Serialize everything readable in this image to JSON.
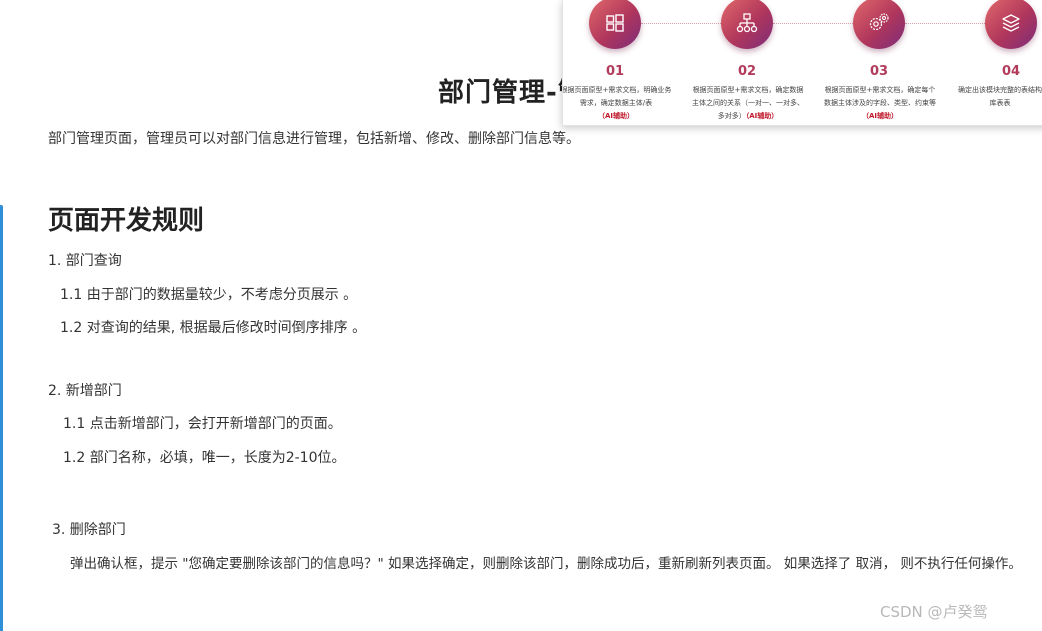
{
  "doc": {
    "title": "部门管理-管理",
    "intro": "部门管理页面，管理员可以对部门信息进行管理，包括新增、修改、删除部门信息等。",
    "section_title": "页面开发规则",
    "items": [
      {
        "heading": "1. 部门查询",
        "subs": [
          "1.1  由于部门的数据量较少，不考虑分页展示 。",
          "1.2  对查询的结果, 根据最后修改时间倒序排序 。"
        ]
      },
      {
        "heading": "2. 新增部门",
        "subs": [
          "1.1 点击新增部门，会打开新增部门的页面。",
          "1.2 部门名称，必填，唯一，长度为2-10位。"
        ]
      },
      {
        "heading": "3.  删除部门",
        "subs": [
          "弹出确认框，提示 \"您确定要删除该部门的信息吗？\"  如果选择确定，则删除该部门，删除成功后，重新刷新列表页面。   如果选择了 取消，  则不执行任何操作。"
        ]
      }
    ]
  },
  "overlay": {
    "steps": [
      {
        "num": "01",
        "icon": "windows-grid-icon",
        "desc": "根据页面原型+需求文档，明确业务需求，确定数据主体/表",
        "ai": "（AI辅助）"
      },
      {
        "num": "02",
        "icon": "hierarchy-icon",
        "desc": "根据页面原型+需求文档，确定数据主体之间的关系（一对一、一对多、多对多）",
        "ai": "（AI辅助）"
      },
      {
        "num": "03",
        "icon": "gears-icon",
        "desc": "根据页面原型+需求文档，确定每个数据主体涉及的字段、类型、约束等",
        "ai": "（AI辅助）"
      },
      {
        "num": "04",
        "icon": "layers-icon",
        "desc": "确定出该模块完整的表结构库表表",
        "ai": ""
      }
    ]
  },
  "watermark": "CSDN @卢癸鸳",
  "colors": {
    "accent": "#b23a5a",
    "ai_tag": "#c0182b",
    "left_rule": "#2f8fd8"
  }
}
